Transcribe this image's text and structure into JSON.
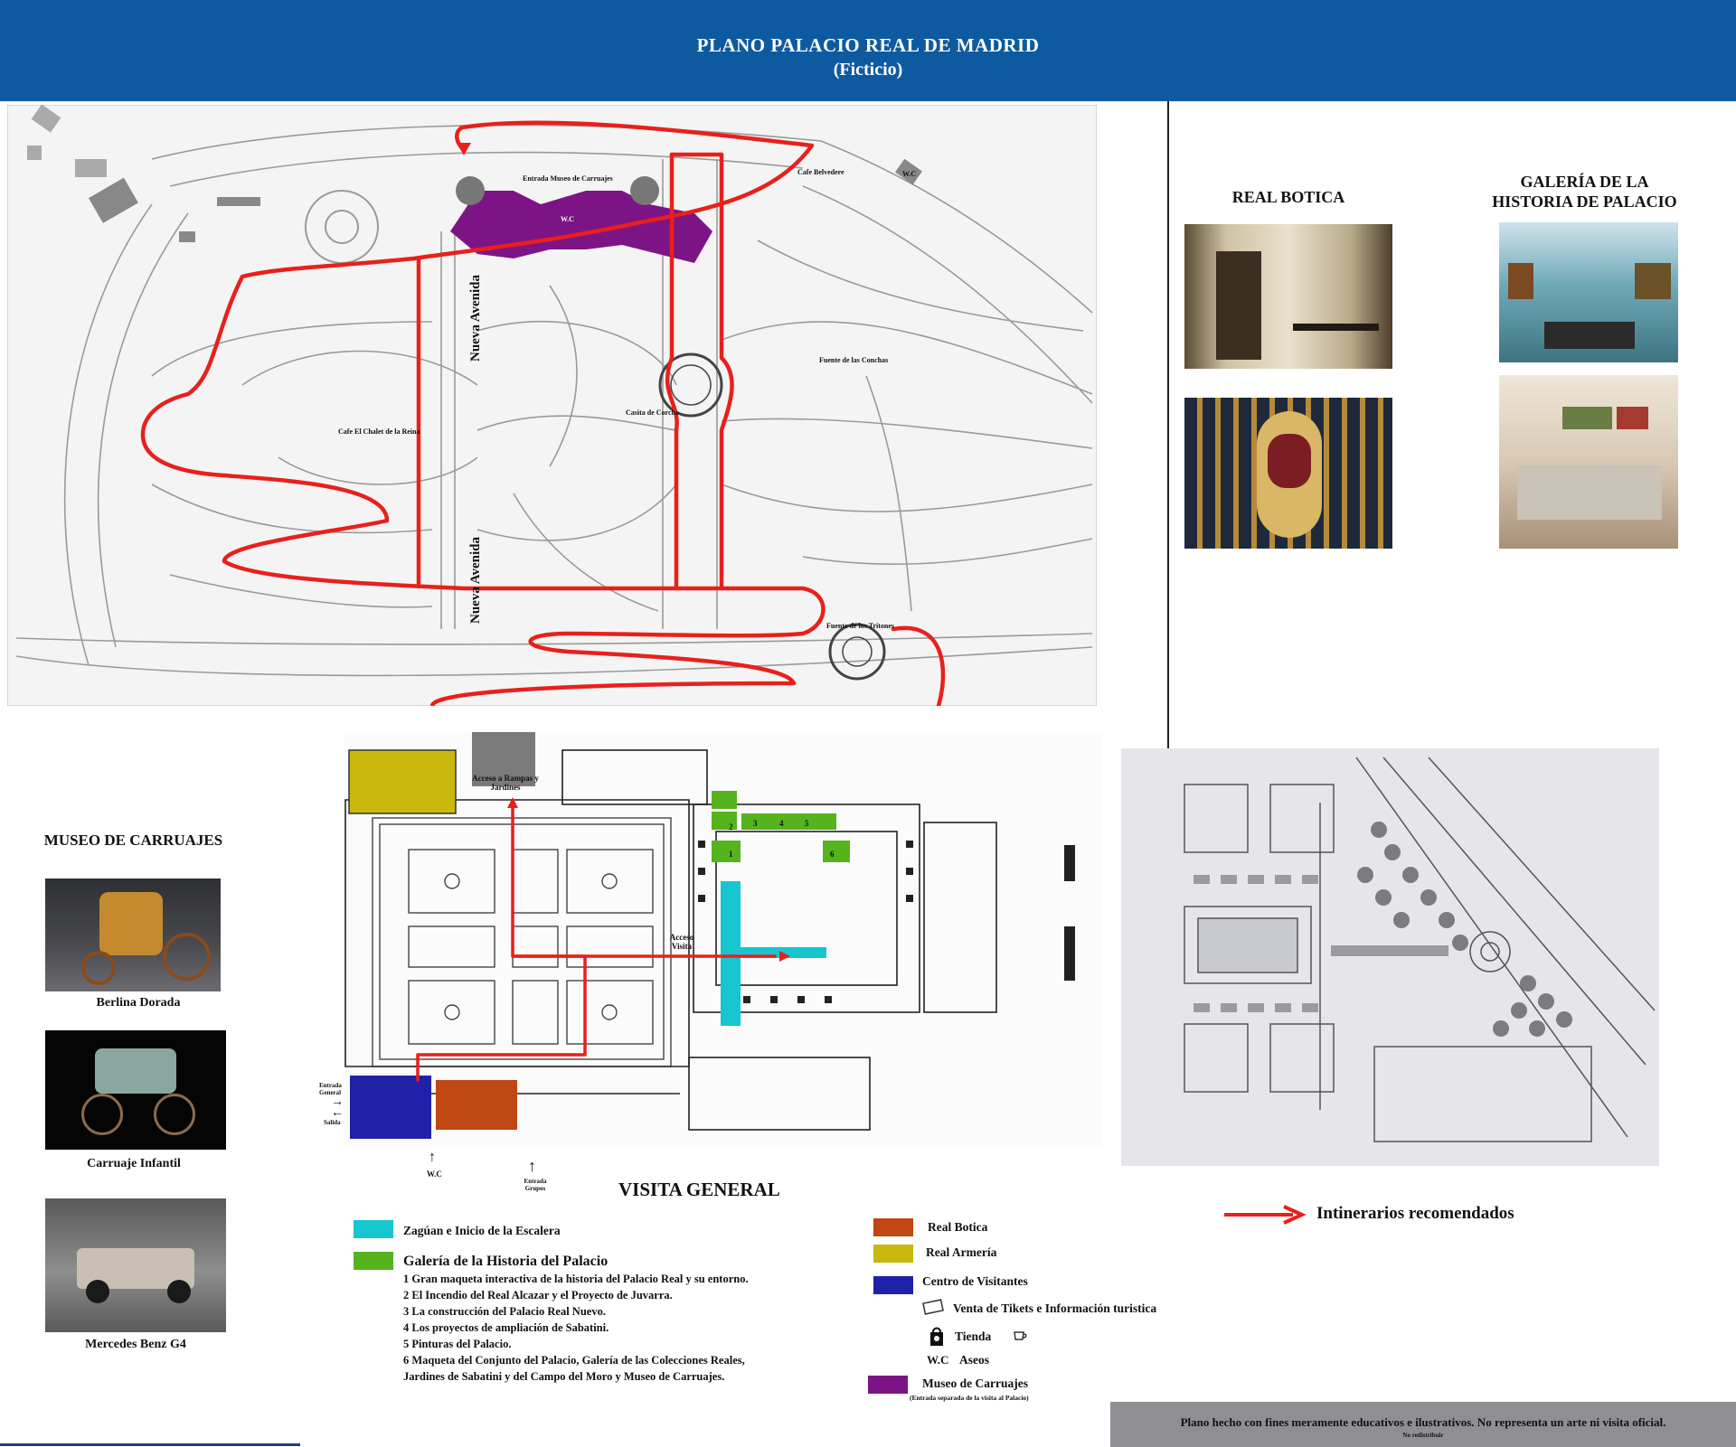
{
  "header": {
    "title": "PLANO  PALACIO REAL DE MADRID",
    "subtitle": "(Ficticio)"
  },
  "map": {
    "park_labels": {
      "entrada_museo": "Entrada Museo de Carruajes",
      "cafe_belvedere": "Cafe Belvedere",
      "wc_park": "W.C",
      "wc_museo": "W.C",
      "nueva_avenida_top": "Nueva Avenida",
      "nueva_avenida_bottom": "Nueva Avenida",
      "fuente_conchas": "Fuente de las Conchas",
      "casita_corcho": "Casita de Corcho",
      "cafe_chalet": "Cafe El Chalet de la Reina",
      "fuente_tritones": "Fuente de los Tritones"
    },
    "palace_labels": {
      "acceso_rampas": "Acceso a Rampas y Jardines",
      "acceso_visita": "Acceso Visita",
      "entrada_general": "Entrada General",
      "salida": "Salida",
      "wc": "W.C",
      "entrada_grupos": "Entrada Grupos",
      "visita_general": "VISITA GENERAL",
      "gallery_numbers": [
        "1",
        "2",
        "3",
        "4",
        "5",
        "6"
      ]
    }
  },
  "real_botica": {
    "title": "REAL BOTICA"
  },
  "galeria": {
    "title": "GALERÍA DE LA HISTORIA DE PALACIO"
  },
  "museo": {
    "title": "MUSEO DE CARRUAJES",
    "items": [
      {
        "caption": "Berlina Dorada"
      },
      {
        "caption": "Carruaje Infantil"
      },
      {
        "caption": "Mercedes Benz G4"
      }
    ]
  },
  "legend": {
    "itinerario": "Intinerarios recomendados",
    "zaguan": "Zagúan e Inicio de la Escalera",
    "galeria_historia": "Galería de la Historia del Palacio",
    "galeria_items": [
      "1 Gran maqueta interactiva de la historia del Palacio Real y su entorno.",
      "2 El Incendio del Real Alcazar y el Proyecto de Juvarra.",
      "3 La construcción del Palacio Real Nuevo.",
      "4 Los proyectos de ampliación de Sabatini.",
      "5 Pinturas del Palacio.",
      "6 Maqueta del Conjunto del Palacio, Galería de las Colecciones Reales,",
      "Jardines de Sabatini y del Campo del Moro  y Museo de Carruajes."
    ],
    "real_botica": "Real Botica",
    "real_armeria": "Real Armería",
    "centro_visitantes": "Centro de Visitantes",
    "venta_tikets": "Venta de Tikets e Información turistica",
    "tienda": "Tienda",
    "wc_symbol": "W.C",
    "aseos": "Aseos",
    "museo_carruajes": "Museo de Carruajes",
    "museo_note": "(Entrada separada de la visita al Palacio)"
  },
  "footer": {
    "note": "Plano hecho con fines meramente educativos e ilustrativos. No representa un arte ni visita oficial.",
    "note_small": "No redistribuir"
  },
  "colors": {
    "header": "#0e5aa1",
    "route": "#e8201c",
    "zaguan": "#17c6cf",
    "galeria": "#55b31e",
    "botica": "#bf4713",
    "armeria": "#c9b90e",
    "centro": "#1f21a8",
    "museo": "#7d1485"
  }
}
